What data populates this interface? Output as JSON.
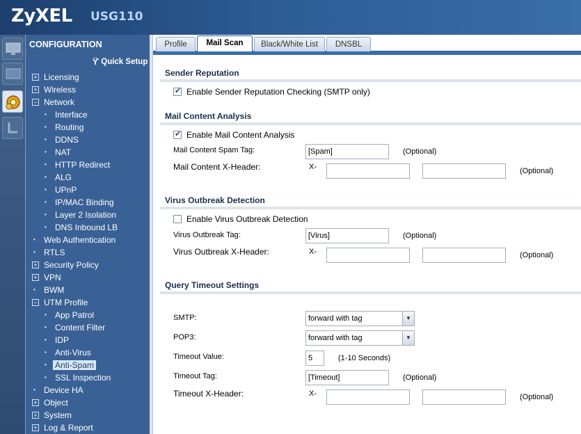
{
  "brand": {
    "logo": "ZyXEL",
    "model": "USG110"
  },
  "sidebar": {
    "title": "CONFIGURATION",
    "quick_setup": "Quick Setup",
    "items": [
      {
        "label": "Licensing",
        "level": "top",
        "exp": "+"
      },
      {
        "label": "Wireless",
        "level": "top",
        "exp": "+"
      },
      {
        "label": "Network",
        "level": "top",
        "exp": "−"
      },
      {
        "label": "Interface",
        "level": "sub"
      },
      {
        "label": "Routing",
        "level": "sub"
      },
      {
        "label": "DDNS",
        "level": "sub"
      },
      {
        "label": "NAT",
        "level": "sub"
      },
      {
        "label": "HTTP Redirect",
        "level": "sub"
      },
      {
        "label": "ALG",
        "level": "sub"
      },
      {
        "label": "UPnP",
        "level": "sub"
      },
      {
        "label": "IP/MAC Binding",
        "level": "sub"
      },
      {
        "label": "Layer 2 Isolation",
        "level": "sub"
      },
      {
        "label": "DNS Inbound LB",
        "level": "sub"
      },
      {
        "label": "Web Authentication",
        "level": "topdot"
      },
      {
        "label": "RTLS",
        "level": "topdot"
      },
      {
        "label": "Security Policy",
        "level": "top",
        "exp": "+"
      },
      {
        "label": "VPN",
        "level": "top",
        "exp": "+"
      },
      {
        "label": "BWM",
        "level": "topdot"
      },
      {
        "label": "UTM Profile",
        "level": "top",
        "exp": "−"
      },
      {
        "label": "App Patrol",
        "level": "sub"
      },
      {
        "label": "Content Filter",
        "level": "sub"
      },
      {
        "label": "IDP",
        "level": "sub"
      },
      {
        "label": "Anti-Virus",
        "level": "sub"
      },
      {
        "label": "Anti-Spam",
        "level": "sub",
        "selected": true
      },
      {
        "label": "SSL Inspection",
        "level": "sub"
      },
      {
        "label": "Device HA",
        "level": "topdot"
      },
      {
        "label": "Object",
        "level": "top",
        "exp": "+"
      },
      {
        "label": "System",
        "level": "top",
        "exp": "+"
      },
      {
        "label": "Log & Report",
        "level": "top",
        "exp": "+"
      }
    ]
  },
  "tabs": [
    {
      "label": "Profile",
      "active": false
    },
    {
      "label": "Mail Scan",
      "active": true
    },
    {
      "label": "Black/White List",
      "active": false
    },
    {
      "label": "DNSBL",
      "active": false
    }
  ],
  "sender": {
    "title": "Sender Reputation",
    "checkbox_label": "Enable Sender Reputation Checking (SMTP only)",
    "checked": true
  },
  "mca": {
    "title": "Mail Content Analysis",
    "checkbox_label": "Enable Mail Content Analysis",
    "checked": true,
    "spam_tag_label": "Mail Content Spam Tag:",
    "spam_tag_value": "[Spam]",
    "optional": "(Optional)",
    "xheader_label": "Mail Content X-Header:",
    "x_prefix": "X-",
    "xheader_name": "",
    "xheader_value": ""
  },
  "vod": {
    "title": "Virus Outbreak Detection",
    "checkbox_label": "Enable Virus Outbreak Detection",
    "checked": false,
    "tag_label": "Virus Outbreak Tag:",
    "tag_value": "[Virus]",
    "optional": "(Optional)",
    "xheader_label": "Virus Outbreak X-Header:",
    "x_prefix": "X-",
    "xheader_name": "",
    "xheader_value": ""
  },
  "qts": {
    "title": "Query Timeout Settings",
    "smtp_label": "SMTP:",
    "smtp_value": "forward with tag",
    "pop3_label": "POP3:",
    "pop3_value": "forward with tag",
    "timeout_label": "Timeout Value:",
    "timeout_value": "5",
    "timeout_range": "(1-10 Seconds)",
    "tag_label": "Timeout Tag:",
    "tag_value": "[Timeout]",
    "optional": "(Optional)",
    "xheader_label": "Timeout X-Header:",
    "x_prefix": "X-",
    "xheader_name": "",
    "xheader_value": ""
  },
  "colors": {
    "header": "#2c5b93",
    "sidebar": "#3a6196",
    "accent": "#3a6ea8"
  },
  "icons": [
    "monitor-icon",
    "maintenance-icon",
    "configuration-gear-icon",
    "report-icon",
    "quick-setup-wand-icon",
    "checkbox-check-icon",
    "dropdown-arrow-icon"
  ]
}
